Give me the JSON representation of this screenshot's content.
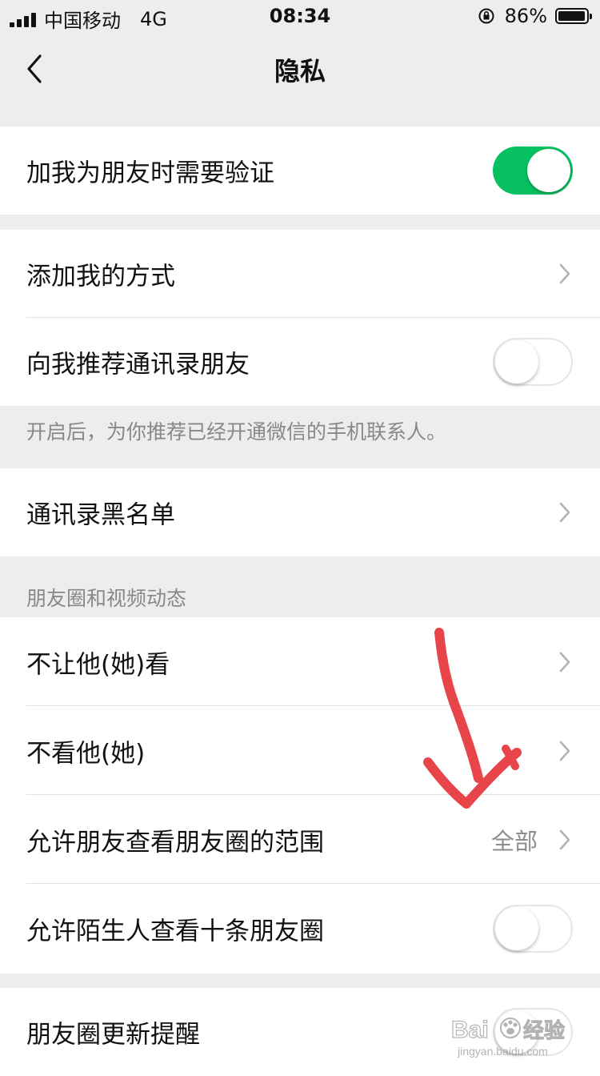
{
  "status_bar": {
    "carrier": "中国移动",
    "network": "4G",
    "time": "08:34",
    "battery_percent": "86%",
    "battery_level": 0.86
  },
  "nav": {
    "title": "隐私",
    "back_icon": "chevron-left-icon"
  },
  "sections": {
    "verify": {
      "label": "加我为朋友时需要验证",
      "toggle_on": true
    },
    "add_methods": {
      "label": "添加我的方式"
    },
    "recommend": {
      "label": "向我推荐通讯录朋友",
      "toggle_on": false,
      "note": "开启后，为你推荐已经开通微信的手机联系人。"
    },
    "blacklist": {
      "label": "通讯录黑名单"
    },
    "moments": {
      "header": "朋友圈和视频动态",
      "hide_from": {
        "label": "不让他(她)看"
      },
      "hide_their": {
        "label": "不看他(她)"
      },
      "range": {
        "label": "允许朋友查看朋友圈的范围",
        "value": "全部"
      },
      "strangers": {
        "label": "允许陌生人查看十条朋友圈",
        "toggle_on": false
      }
    },
    "updates": {
      "label": "朋友圈更新提醒"
    }
  },
  "colors": {
    "toggle_on": "#07c160",
    "background": "#ededed",
    "annotation_arrow": "#e8454a"
  },
  "watermark": {
    "text": "Baidu经验",
    "subtext": "jingyan.baidu.com"
  }
}
